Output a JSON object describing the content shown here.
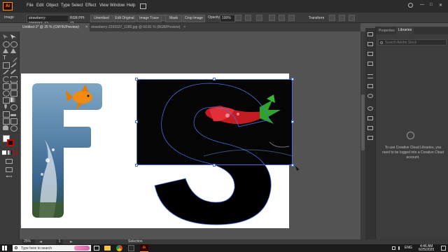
{
  "menubar": {
    "items": [
      "File",
      "Edit",
      "Object",
      "Type",
      "Select",
      "Effect",
      "View",
      "Window",
      "Help"
    ],
    "window_controls": {
      "minimize": "—",
      "maximize": "□",
      "close": "✕"
    }
  },
  "control_bar": {
    "object_type": "Image",
    "filename": "strawberry-2293337_12...",
    "color_mode": "RGB PPI: 72",
    "embed_status": "Unembed",
    "edit_original": "Edit Original",
    "image_trace": "Image Trace",
    "mask": "Mask",
    "crop_image": "Crop Image",
    "opacity_label": "Opacity:",
    "opacity_value": "100%",
    "transform": "Transform"
  },
  "tabs": [
    {
      "label": "Untitled-1* @ 25 % (CMYK/Preview)",
      "close": "×",
      "active": true
    },
    {
      "label": "strawberry-2293337_1280.jpg @ 60.81 % (RGB/Preview)",
      "close": "×",
      "active": false
    }
  ],
  "panel": {
    "tabs": [
      "Properties",
      "Libraries"
    ],
    "search_placeholder": "Search Adobe Stock",
    "message": "To use Creative Cloud Libraries, you need to be logged into a Creative Cloud account."
  },
  "status_bar": {
    "zoom": "25%",
    "artboard_number": "1",
    "selection_tool": "Selection"
  },
  "taskbar": {
    "search_placeholder": "Type here to search",
    "language": "ENG",
    "time": "4:46 AM",
    "date": "6/25/2020"
  },
  "colors": {
    "accent": "#ff9a00",
    "selection": "#4a6ee0"
  }
}
